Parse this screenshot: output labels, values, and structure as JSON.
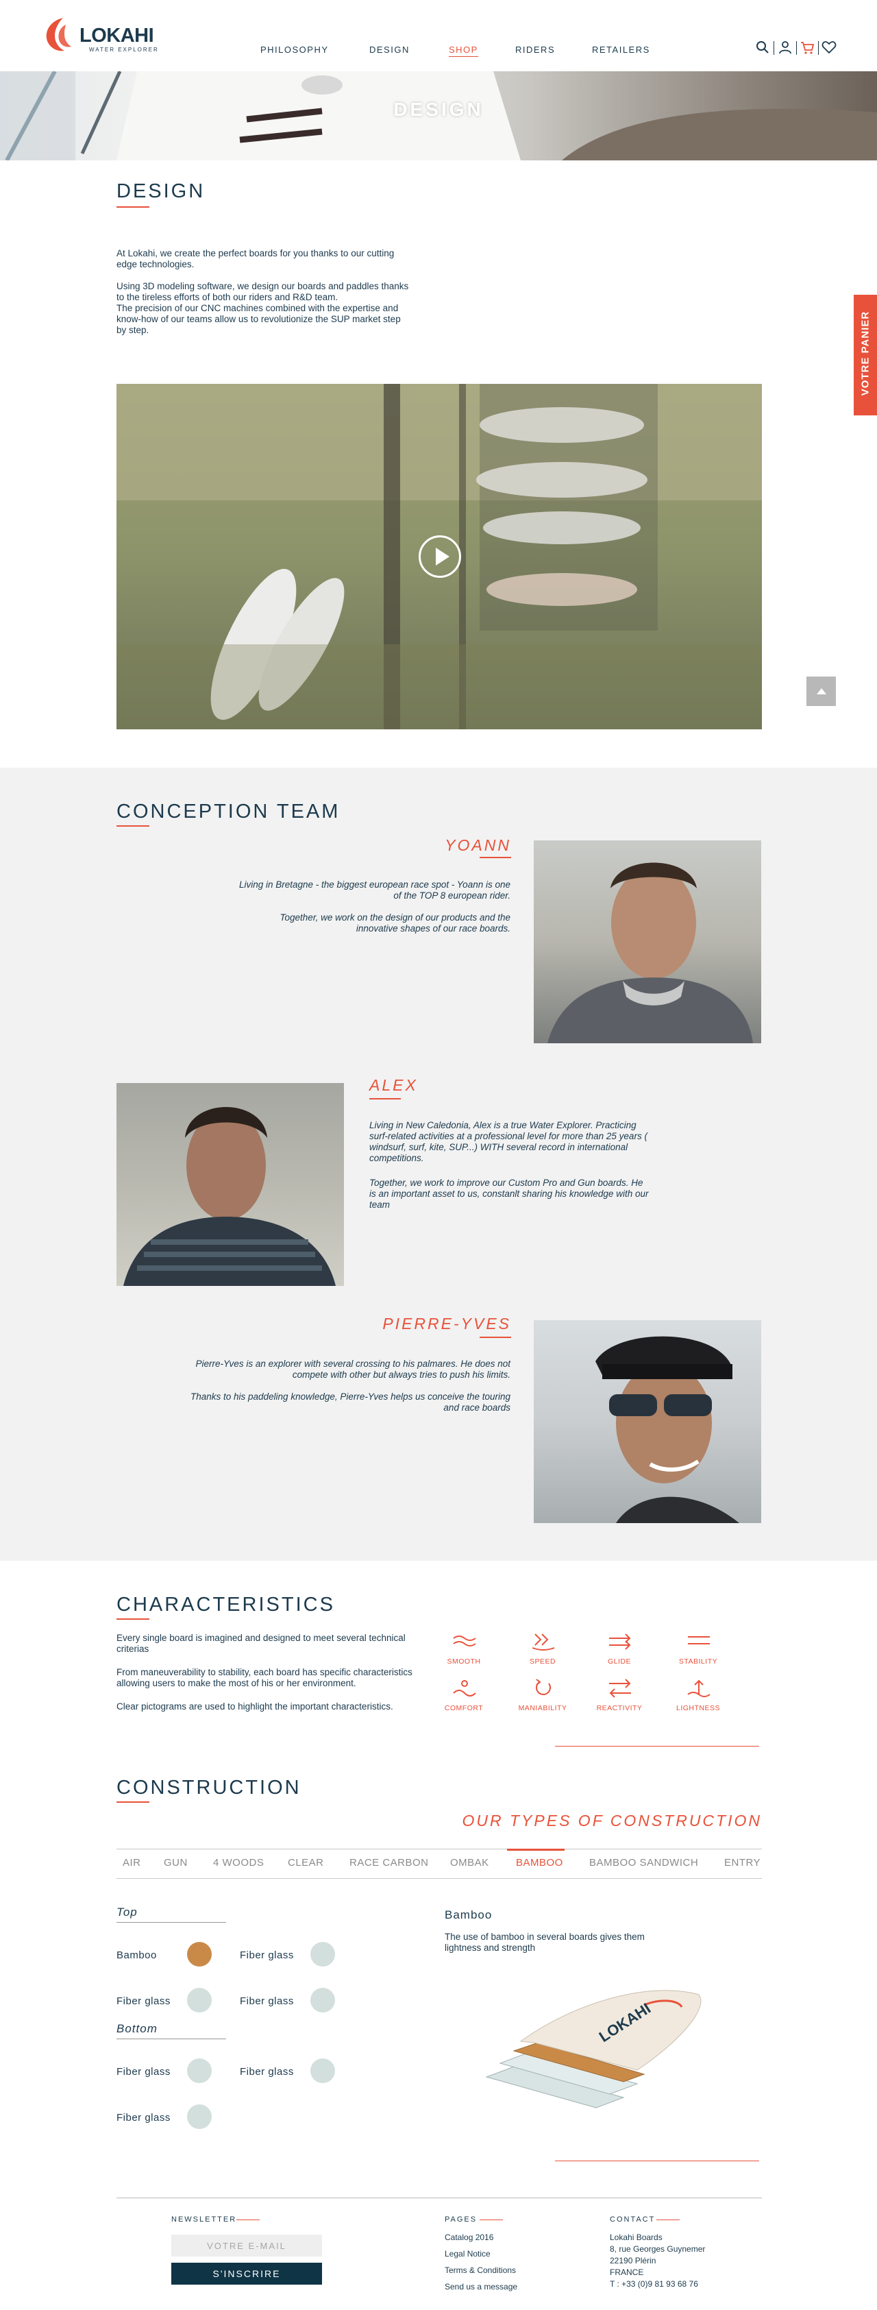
{
  "header": {
    "brand": "LOKAHI",
    "tagline": "WATER EXPLORER",
    "nav": [
      {
        "label": "PHILOSOPHY"
      },
      {
        "label": "DESIGN"
      },
      {
        "label": "SHOP",
        "active": true
      },
      {
        "label": "RIDERS"
      },
      {
        "label": "RETAILERS"
      }
    ],
    "icons": [
      "search-icon",
      "user-icon",
      "cart-icon",
      "heart-icon"
    ]
  },
  "banner": {
    "title": "DESIGN"
  },
  "design": {
    "title": "DESIGN",
    "p1": "At Lokahi, we create the perfect boards for you thanks to our cutting edge technologies.",
    "p2": "Using 3D modeling software, we design our boards and paddles thanks to the tireless efforts of both our riders and R&D team.",
    "p3": "The precision of our CNC machines combined with the expertise and know-how of our teams allow us to revolutionize the SUP market step by step."
  },
  "cart_tab": "VOTRE PANIER",
  "team": {
    "title": "CONCEPTION TEAM",
    "members": [
      {
        "name": "YOANN",
        "p1": "Living in Bretagne - the biggest european race spot - Yoann is one of the TOP 8 european rider.",
        "p2": "Together, we work on the design of our products and the innovative shapes of our race boards."
      },
      {
        "name": "ALEX",
        "p1": "Living in New Caledonia, Alex is a true Water Explorer. Practicing surf-related activities at a professional level for more than 25 years ( windsurf, surf, kite, SUP...) WITH several record in international competitions.",
        "p2": "Together, we work to improve our Custom Pro and Gun boards. He is an important asset to us, constanlt sharing his knowledge with our team"
      },
      {
        "name": "PIERRE-YVES",
        "p1": "Pierre-Yves is an explorer with several crossing to his palmares. He does not compete with other but always tries to push his limits.",
        "p2": "Thanks to his paddeling knowledge, Pierre-Yves helps us conceive the touring and race boards"
      }
    ]
  },
  "characteristics": {
    "title": "CHARACTERISTICS",
    "p1": "Every single board is imagined and designed to meet several technical criterias",
    "p2": "From maneuverability to stability, each board has specific characteristics allowing users to make the most of his or her environment.",
    "p3": "Clear pictograms are used to highlight the important characteristics.",
    "items": [
      {
        "label": "SMOOTH",
        "icon": "smooth-icon"
      },
      {
        "label": "SPEED",
        "icon": "speed-icon"
      },
      {
        "label": "GLIDE",
        "icon": "glide-icon"
      },
      {
        "label": "STABILITY",
        "icon": "stability-icon"
      },
      {
        "label": "COMFORT",
        "icon": "comfort-icon"
      },
      {
        "label": "MANIABILITY",
        "icon": "maniability-icon"
      },
      {
        "label": "REACTIVITY",
        "icon": "reactivity-icon"
      },
      {
        "label": "LIGHTNESS",
        "icon": "lightness-icon"
      }
    ]
  },
  "construction": {
    "title": "CONSTRUCTION",
    "subtitle": "OUR TYPES OF CONSTRUCTION",
    "tabs": [
      "AIR",
      "GUN",
      "4 WOODS",
      "CLEAR",
      "RACE CARBON",
      "OMBAK",
      "BAMBOO",
      "BAMBOO SANDWICH",
      "ENTRY"
    ],
    "active_tab": "BAMBOO",
    "top_label": "Top",
    "bottom_label": "Bottom",
    "top_layers": [
      "Bamboo",
      "Fiber glass",
      "Fiber glass",
      "Fiber glass"
    ],
    "bottom_layers": [
      "Fiber glass",
      "Fiber glass",
      "Fiber glass"
    ],
    "detail_title": "Bamboo",
    "detail_text": "The use of bamboo in several boards gives them lightness and strength",
    "board_brand": "LOKAHI"
  },
  "footer": {
    "newsletter_title": "NEWSLETTER",
    "email_placeholder": "VOTRE E-MAIL",
    "subscribe_label": "S'INSCRIRE",
    "pages_title": "PAGES",
    "pages": [
      "Catalog 2016",
      "Legal Notice",
      "Terms & Conditions",
      "Send us a message"
    ],
    "contact_title": "CONTACT",
    "contact": [
      "Lokahi Boards",
      "8, rue Georges Guynemer",
      "22190 Plérin",
      "FRANCE",
      "T : +33 (0)9 81 93 68 76"
    ]
  },
  "colors": {
    "accent": "#e8523a",
    "navy": "#1c3a4d",
    "button": "#0f3446",
    "team_bg": "#f2f2f2"
  }
}
